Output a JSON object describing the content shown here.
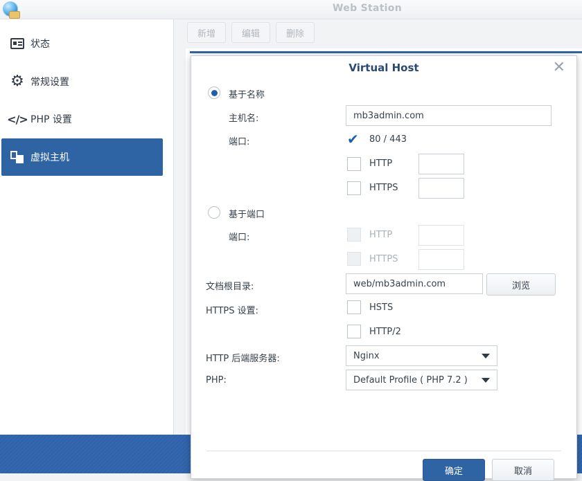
{
  "window": {
    "title": "Web Station"
  },
  "sidebar": {
    "items": [
      {
        "label": "状态",
        "icon": "status-icon"
      },
      {
        "label": "常规设置",
        "icon": "gear-icon"
      },
      {
        "label": "PHP 设置",
        "icon": "code-icon"
      },
      {
        "label": "虚拟主机",
        "icon": "virtual-host-icon",
        "active": true
      }
    ]
  },
  "toolbar": {
    "add_label": "新增",
    "edit_label": "编辑",
    "delete_label": "删除"
  },
  "dialog": {
    "title": "Virtual Host",
    "name_based": {
      "label": "基于名称",
      "selected": true,
      "hostname_label": "主机名:",
      "hostname_value": "mb3admin.com",
      "port_label": "端口:",
      "port_80_443_label": "80 / 443",
      "port_80_443_checked": true,
      "http_label": "HTTP",
      "https_label": "HTTPS"
    },
    "port_based": {
      "label": "基于端口",
      "selected": false,
      "port_label": "端口:",
      "http_label": "HTTP",
      "https_label": "HTTPS"
    },
    "doc_root_label": "文档根目录:",
    "doc_root_value": "web/mb3admin.com",
    "browse_label": "浏览",
    "https_settings_label": "HTTPS 设置:",
    "hsts_label": "HSTS",
    "http2_label": "HTTP/2",
    "backend_label": "HTTP 后端服务器:",
    "backend_value": "Nginx",
    "php_label": "PHP:",
    "php_value": "Default Profile ( PHP 7.2 )",
    "ok_label": "确定",
    "cancel_label": "取消"
  },
  "colors": {
    "accent": "#2f64a4",
    "check": "#1f5fa8"
  }
}
